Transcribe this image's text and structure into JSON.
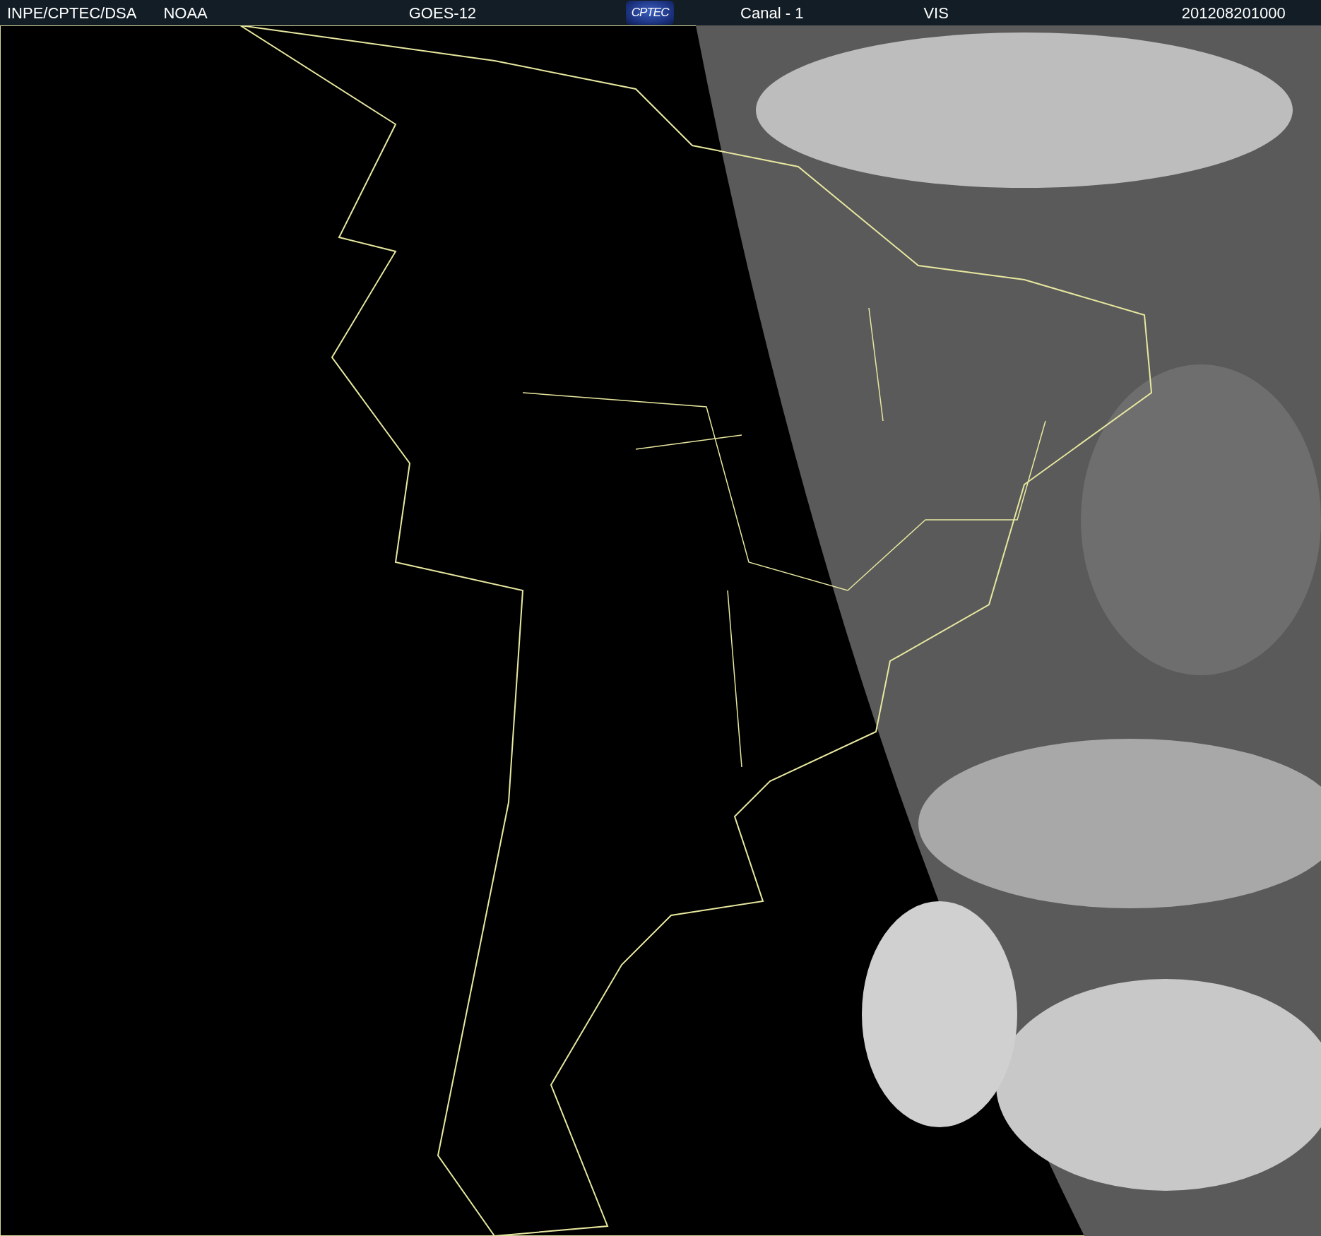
{
  "header": {
    "items": [
      {
        "kind": "text",
        "text": "INPE/CPTEC/DSA"
      },
      {
        "kind": "text",
        "text": "NOAA"
      },
      {
        "kind": "text",
        "text": "GOES-12"
      },
      {
        "kind": "logo",
        "text": "CPTEC"
      },
      {
        "kind": "text",
        "text": "Canal - 1"
      },
      {
        "kind": "text",
        "text": "VIS"
      },
      {
        "kind": "text",
        "text": "201208201000"
      }
    ]
  }
}
